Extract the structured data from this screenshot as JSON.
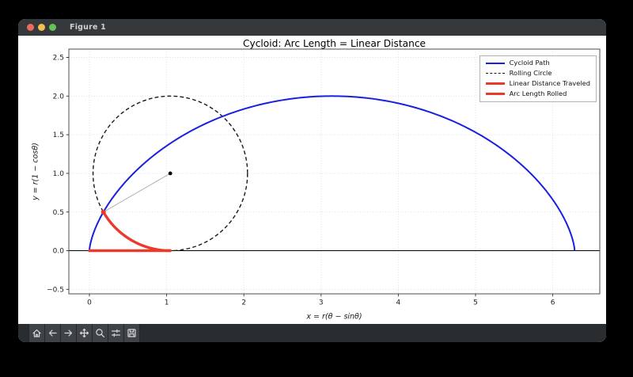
{
  "window": {
    "title": "Figure 1",
    "traffic_lights": {
      "close": "#ed6a5f",
      "minimize": "#f5bf4f",
      "zoom": "#62c454"
    }
  },
  "toolbar": {
    "buttons": [
      {
        "name": "home",
        "icon": "home-icon"
      },
      {
        "name": "back",
        "icon": "arrow-left-icon"
      },
      {
        "name": "forward",
        "icon": "arrow-right-icon"
      },
      {
        "name": "pan",
        "icon": "move-icon"
      },
      {
        "name": "zoom",
        "icon": "magnifier-icon"
      },
      {
        "name": "configure-subplots",
        "icon": "sliders-icon"
      },
      {
        "name": "save",
        "icon": "save-icon"
      }
    ]
  },
  "chart_data": {
    "type": "line",
    "title": "Cycloid: Arc Length = Linear Distance",
    "xlabel": "x = r(θ − sinθ)",
    "ylabel": "y = r(1 − cosθ)",
    "xlim": [
      -0.27,
      6.61
    ],
    "ylim": [
      -0.56,
      2.61
    ],
    "grid": true,
    "xticks": {
      "values": [
        0,
        1,
        2,
        3,
        4,
        5,
        6
      ],
      "labels": [
        "0",
        "1",
        "2",
        "3",
        "4",
        "5",
        "6"
      ]
    },
    "yticks": {
      "values": [
        -0.5,
        0,
        0.5,
        1,
        1.5,
        2,
        2.5
      ],
      "labels": [
        "−0.5",
        "0.0",
        "0.5",
        "1.0",
        "1.5",
        "2.0",
        "2.5"
      ]
    },
    "legend": {
      "position": "upper right",
      "entries": [
        {
          "label": "Cycloid Path",
          "color": "#1a20e0",
          "dash": "solid",
          "weight": 2
        },
        {
          "label": "Rolling Circle",
          "color": "#1a1a1a",
          "dash": "dashed",
          "weight": 1.6
        },
        {
          "label": "Linear Distance Traveled",
          "color": "#e93a2e",
          "dash": "solid",
          "weight": 3
        },
        {
          "label": "Arc Length Rolled",
          "color": "#e93a2e",
          "dash": "solid",
          "weight": 3
        }
      ]
    },
    "params": {
      "r": 1,
      "theta_current": 1.0472,
      "theta_max": 6.2832
    },
    "series": [
      {
        "name": "Cycloid Path",
        "kind": "parametric",
        "equation": "x=r(θ−sinθ), y=r(1−cosθ)",
        "theta_range": [
          0,
          6.2832
        ],
        "points": [
          [
            0,
            0
          ],
          [
            0.01,
            0.076
          ],
          [
            0.078,
            0.293
          ],
          [
            0.254,
            0.617
          ],
          [
            0.571,
            1.0
          ],
          [
            1.04,
            1.383
          ],
          [
            1.649,
            1.707
          ],
          [
            2.366,
            1.924
          ],
          [
            3.142,
            2.0
          ],
          [
            3.917,
            1.924
          ],
          [
            4.634,
            1.707
          ],
          [
            5.244,
            1.383
          ],
          [
            5.712,
            1.0
          ],
          [
            6.029,
            0.617
          ],
          [
            6.205,
            0.293
          ],
          [
            6.273,
            0.076
          ],
          [
            6.283,
            0
          ]
        ]
      },
      {
        "name": "Rolling Circle",
        "kind": "circle",
        "center": [
          1.0472,
          1.0
        ],
        "radius": 1
      },
      {
        "name": "Linear Distance Traveled",
        "kind": "segment",
        "from": [
          0,
          0
        ],
        "to": [
          1.0472,
          0
        ],
        "length": 1.0472
      },
      {
        "name": "Arc Length Rolled",
        "kind": "arc",
        "center": [
          1.0472,
          1.0
        ],
        "radius": 1,
        "from_point": [
          1.0472,
          0
        ],
        "to_point": [
          0.1812,
          0.5
        ],
        "arc_length": 1.0472
      },
      {
        "name": "radius-spoke",
        "kind": "segment",
        "from": [
          1.0472,
          1.0
        ],
        "to": [
          0.1812,
          0.5
        ]
      },
      {
        "name": "circle-center-dot",
        "kind": "point",
        "at": [
          1.0472,
          1.0
        ]
      }
    ],
    "colors": {
      "grid": "#dcdcdc",
      "spine": "#4d4d4d",
      "axis_line": "#000000",
      "spoke": "#b0b0b0",
      "dot": "#000000",
      "background": "#ffffff"
    }
  }
}
